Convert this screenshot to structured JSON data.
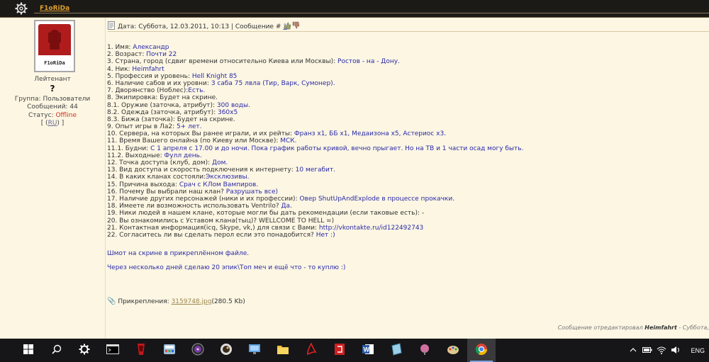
{
  "top": {
    "username": "F1oRiDa"
  },
  "profile": {
    "avatar_name": "F1oRiDa",
    "rank": "Лейтенант",
    "rank_mark": "?",
    "group": "Группа: Пользователи",
    "posts": "Сообщений: 44",
    "status_label": "Статус: ",
    "status_value": "Offline",
    "lang_open": "[ (",
    "lang_code": "RU",
    "lang_close": ") ]"
  },
  "post": {
    "meta_prefix": "Дата: Суббота, 12.03.2011, 10:13 | Сообщение # ",
    "msg_number": "1",
    "questions": [
      {
        "q": "1. Имя: ",
        "a": "Александр"
      },
      {
        "q": "2. Возраст: ",
        "a": "Почти 22"
      },
      {
        "q": "3. Страна, город (сдвиг времени относительно Киева или Москвы): ",
        "a": "Ростов - на - Дону."
      },
      {
        "q": "4. Ник: ",
        "a": "Heimfahrt"
      },
      {
        "q": "5. Профессия и уровень: ",
        "a": "Hell Knight 85"
      },
      {
        "q": "6. Наличие сабов и их уровни: ",
        "a": "3 саба 75 лвла (Тир, Варк, Сумонер)."
      },
      {
        "q": "7. Дворянство (Ноблес):",
        "a": "Есть."
      },
      {
        "q": "8. Экипировка: Будет на скрине.",
        "a": ""
      },
      {
        "q": "8.1. Оружие (заточка, атрибут): ",
        "a": "300 воды."
      },
      {
        "q": "8.2. Одежда (заточка, атрибут): ",
        "a": "360x5"
      },
      {
        "q": "8.3. Бижа (заточка): Будет на скрине.",
        "a": ""
      },
      {
        "q": "9. Опыт игры в Ла2: ",
        "a": "5+ лет."
      },
      {
        "q": "10. Сервера, на которых Вы ранее играли, и их рейты: ",
        "a": "Франз х1, ББ х1, Медаизона х5, Астериос х3."
      },
      {
        "q": "11. Время Вашего онлайна (по Киеву или Москве): ",
        "a": "МСК."
      },
      {
        "q": "11.1. Будни: ",
        "a": "С 1 апреля с 17.00 и до ночи. Пока график работы кривой, вечно прыгает. Но на ТВ и 1 части осад могу быть."
      },
      {
        "q": "11.2. Выходные: ",
        "a": "Фулл день."
      },
      {
        "q": "12. Точка доступа (клуб, дом): ",
        "a": "Дом."
      },
      {
        "q": "13. Вид доступа и скорость подключения к интернету: ",
        "a": "10 мегабит."
      },
      {
        "q": "14. В каких кланах состояли:",
        "a": "Эксклюзивы."
      },
      {
        "q": "15. Причина выхода: ",
        "a": "Срач с КЛом Вампиров."
      },
      {
        "q": "16. Почему Вы выбрали наш клан? ",
        "a": "Разрушать все)"
      },
      {
        "q": "17. Наличие других персонажей (ники и их профессии): ",
        "a": "Овер ShutUpAndExplode в процессе прокачки."
      },
      {
        "q": "18. Имеете ли возможность использовать Ventrilo? ",
        "a": "Да."
      },
      {
        "q": "19. Ники людей в нашем клане, которые могли бы дать рекомендации (если таковые есть): -",
        "a": ""
      },
      {
        "q": "20. Вы ознакомились с Уставом клана(тыц)?",
        "link": "(тыц)",
        "tail": " WELLCOME TO HELL =)"
      },
      {
        "q": "21. Контактная информация(icq, Skype, vk,) для связи с Вами: ",
        "a": "http://vkontakte.ru/id122492743"
      },
      {
        "q": "22. Согласитесь ли вы сделать перол если это понадобится? ",
        "a": "Нет :)"
      }
    ],
    "extra1": "Шмот на скрине в прикреплённом файле.",
    "extra2": "Через несколько дней сделаю 20 эпик\\Топ меч и ещё что - то куплю :)",
    "attach_label": "Прикрепления: ",
    "attach_file": "3159748.jpg",
    "attach_size": "(280.5 Kb)",
    "edit_prefix": "Сообщение отредактировал ",
    "edit_user": "Heimfahrt",
    "edit_suffix": " - Суббота,"
  },
  "taskbar": {
    "language": "ENG",
    "icons": [
      "windows-start-icon",
      "search-icon",
      "settings-icon",
      "terminal-icon",
      "game-icon",
      "calculator-icon",
      "media-player-icon",
      "photos-icon",
      "network-icon",
      "file-explorer-icon",
      "pdf-icon",
      "pdf-reader-icon",
      "word-icon",
      "notepad-icon",
      "paint-icon",
      "brush-icon",
      "chrome-icon"
    ]
  }
}
